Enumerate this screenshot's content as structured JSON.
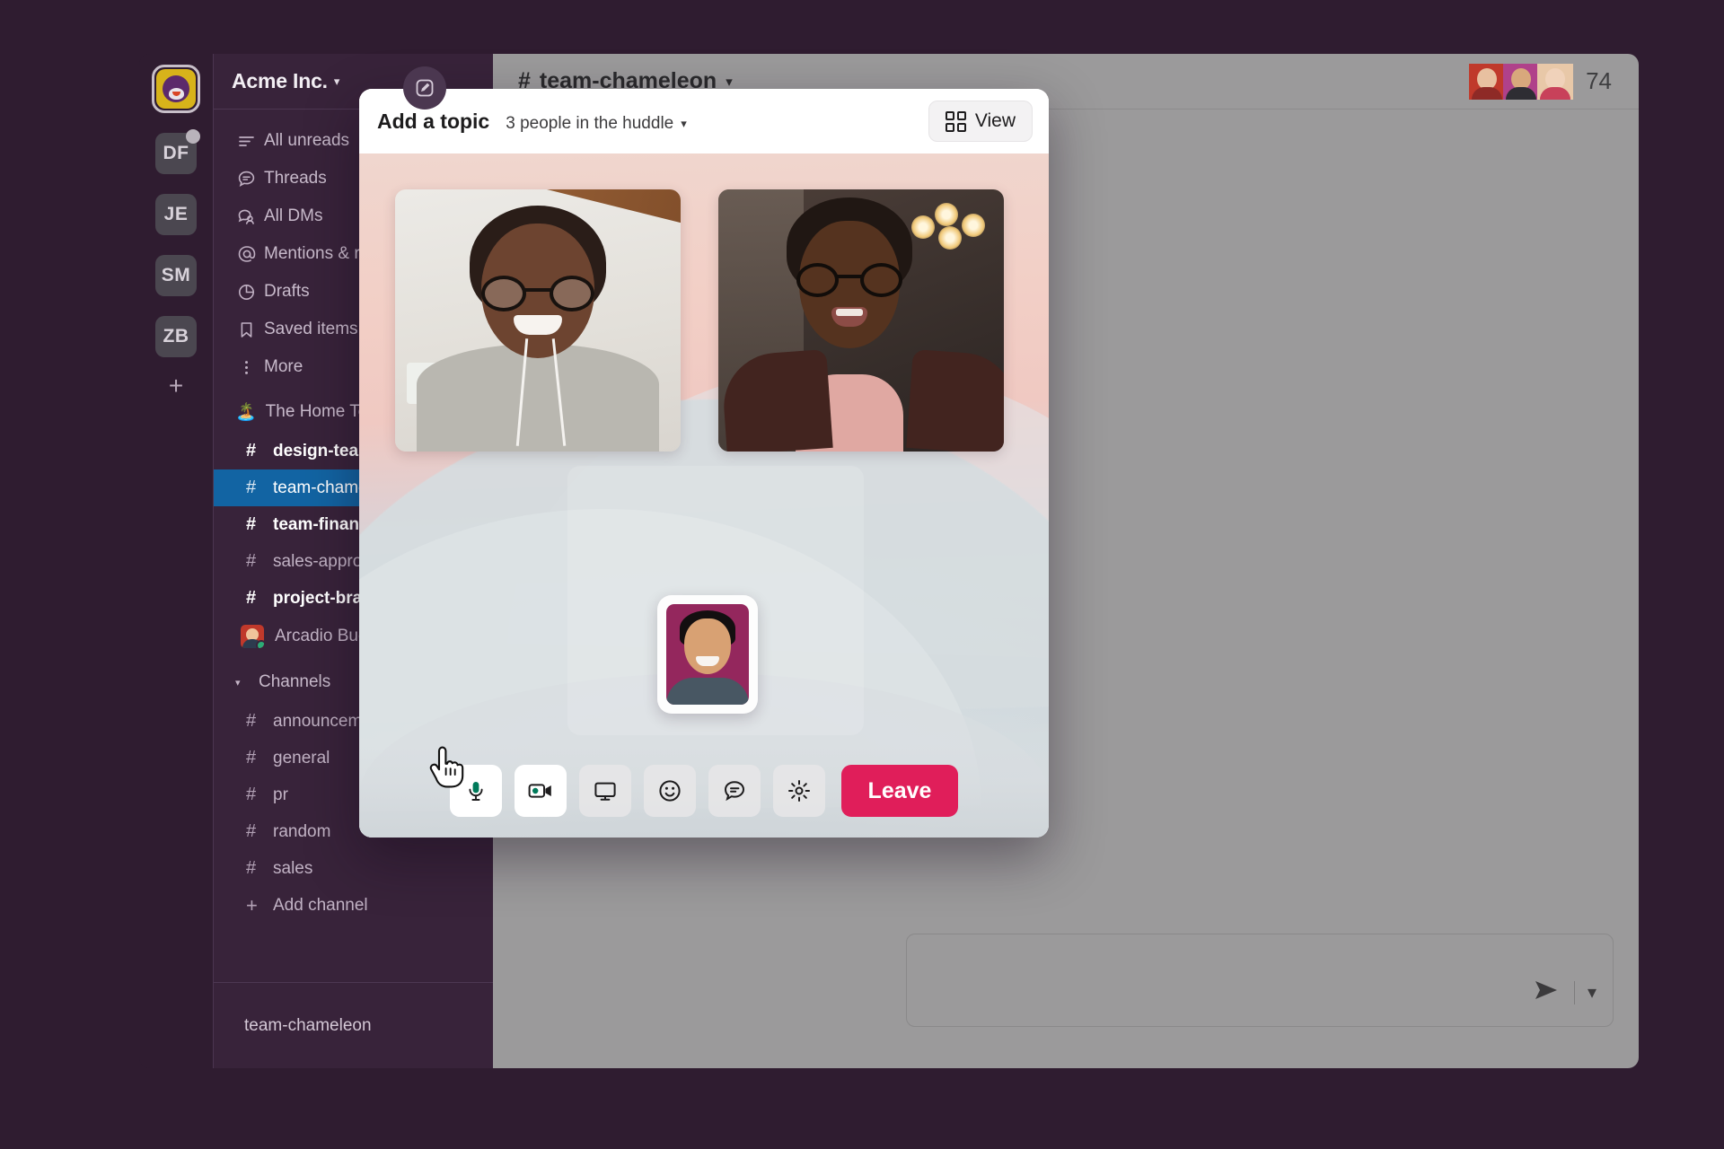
{
  "workspace": {
    "name": "Acme Inc.",
    "chevron": "⌄",
    "logo_color": "#d7b31a",
    "rail_items": [
      {
        "initials": "DF",
        "has_badge": true
      },
      {
        "initials": "JE",
        "has_badge": false
      },
      {
        "initials": "SM",
        "has_badge": false
      },
      {
        "initials": "ZB",
        "has_badge": false
      }
    ],
    "add_workspace": "+"
  },
  "sidebar": {
    "nav": [
      {
        "label": "All unreads",
        "icon": "unreads-icon"
      },
      {
        "label": "Threads",
        "icon": "threads-icon"
      },
      {
        "label": "All DMs",
        "icon": "dms-icon"
      },
      {
        "label": "Mentions & reactions",
        "icon": "at-mention-icon"
      },
      {
        "label": "Drafts",
        "icon": "drafts-icon"
      },
      {
        "label": "Saved items",
        "icon": "bookmark-icon"
      },
      {
        "label": "More",
        "icon": "more-kebab-icon"
      }
    ],
    "section_home": {
      "emoji": "🏝️",
      "label": "The Home Team"
    },
    "home_channels": [
      {
        "name": "design-team",
        "unread": true,
        "active": false
      },
      {
        "name": "team-chameleon",
        "unread": false,
        "active": true
      },
      {
        "name": "team-finance",
        "unread": true,
        "active": false
      },
      {
        "name": "sales-approvals",
        "unread": false,
        "active": false
      },
      {
        "name": "project-brand-campaign",
        "unread": true,
        "active": false
      }
    ],
    "dm": {
      "name": "Arcadio Buendia",
      "presence": "active",
      "presence_color": "#2bac76"
    },
    "section_channels": {
      "label": "Channels",
      "caret": "▾"
    },
    "channels": [
      {
        "name": "announcements"
      },
      {
        "name": "general"
      },
      {
        "name": "pr"
      },
      {
        "name": "random"
      },
      {
        "name": "sales"
      }
    ],
    "add_channel": {
      "label": "Add channel",
      "glyph": "+"
    },
    "footer_huddle": {
      "label": "team-chameleon"
    },
    "active_color": "#1264a3",
    "bg_color": "#38233a"
  },
  "channel_header": {
    "hash": "#",
    "title": "team-chameleon",
    "chevron": "⌄",
    "member_count": "74",
    "compose_icon": "compose-pencil-icon",
    "avatars": [
      {
        "bg": "#c0392b",
        "skin": "#e8c0a0",
        "body": "#8e2a26"
      },
      {
        "bg": "#b0418a",
        "skin": "#d8a87c",
        "body": "#2e2d33"
      },
      {
        "bg": "#e8c8a8",
        "skin": "#f0d2ba",
        "body": "#c8415a"
      }
    ]
  },
  "composer": {
    "send_icon": "send-arrow-icon",
    "chevron": "⌄"
  },
  "huddle": {
    "topic_label": "Add a topic",
    "people_label": "3 people in the huddle",
    "people_chevron": "⌄",
    "view_button": {
      "label": "View",
      "icon": "grid-view-icon"
    },
    "tiles": [
      {
        "name": "participant-video-1",
        "label": ""
      },
      {
        "name": "participant-video-2",
        "label": ""
      }
    ],
    "avatar_participant": {
      "name": "participant-avatar-3",
      "bg": "#94275d"
    },
    "controls": [
      {
        "name": "mic-button",
        "icon": "microphone-icon",
        "state": "on",
        "accent": "#007a5a"
      },
      {
        "name": "video-button",
        "icon": "video-camera-icon",
        "state": "on",
        "accent": "#007a5a"
      },
      {
        "name": "share-screen-button",
        "icon": "monitor-screen-icon",
        "state": "off",
        "accent": "#1d1c1d"
      },
      {
        "name": "reactions-button",
        "icon": "smiley-face-icon",
        "state": "off",
        "accent": "#1d1c1d"
      },
      {
        "name": "huddle-thread-button",
        "icon": "chat-bubble-icon",
        "state": "off",
        "accent": "#1d1c1d"
      },
      {
        "name": "settings-button",
        "icon": "gear-icon",
        "state": "off",
        "accent": "#1d1c1d"
      }
    ],
    "leave_button": {
      "label": "Leave",
      "color": "#e01e5a"
    }
  },
  "cursor": {
    "icon": "pointing-hand-cursor"
  }
}
